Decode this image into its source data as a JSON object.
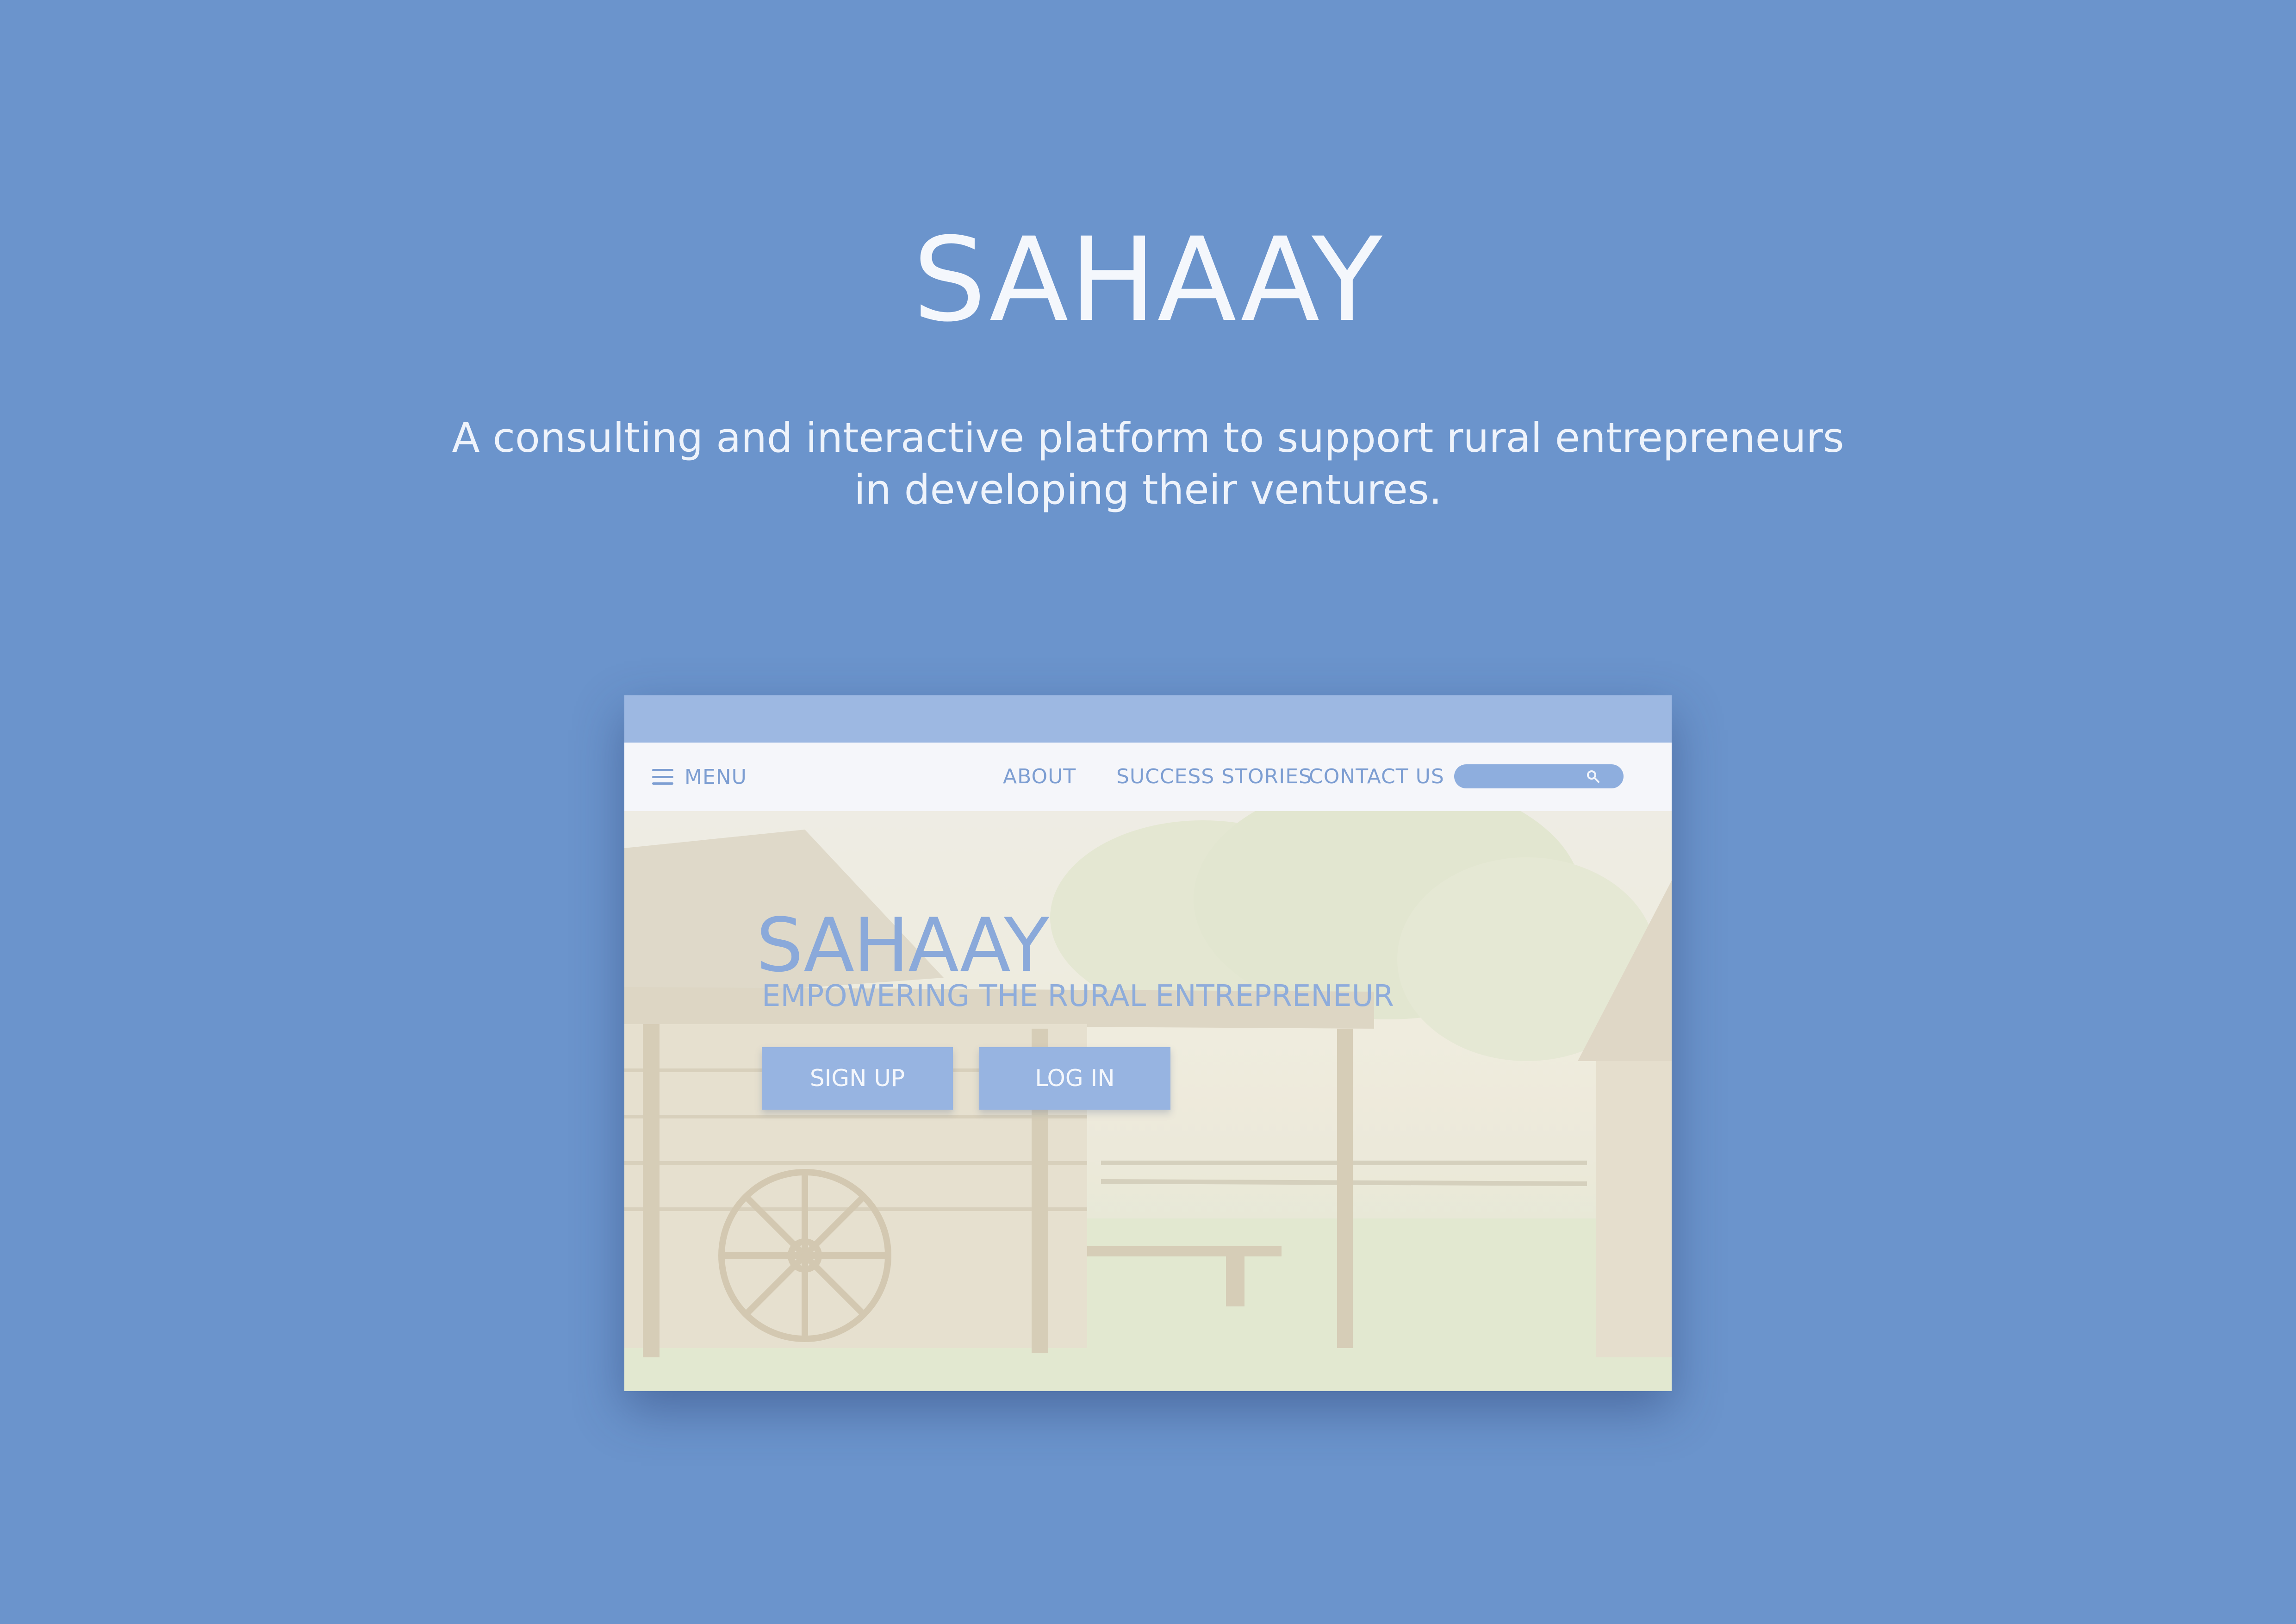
{
  "hero": {
    "title": "SAHAAY",
    "subtitle_line1": "A consulting and interactive platform to support rural entrepreneurs",
    "subtitle_line2": "in developing their ventures."
  },
  "mockup": {
    "nav": {
      "menu_label": "MENU",
      "menu_icon": "hamburger-icon",
      "links": [
        "ABOUT",
        "SUCCESS STORIES",
        "CONTACT US"
      ],
      "search_icon": "search-icon"
    },
    "hero": {
      "title": "SAHAAY",
      "tagline": "EMPOWERING THE RURAL ENTREPRENEUR",
      "signup_label": "SIGN UP",
      "login_label": "LOG IN"
    }
  },
  "colors": {
    "background": "#6b94cc",
    "accent": "#97b4e1",
    "nav_text": "#7d9ed2",
    "chrome_bar": "#9db8e2"
  }
}
